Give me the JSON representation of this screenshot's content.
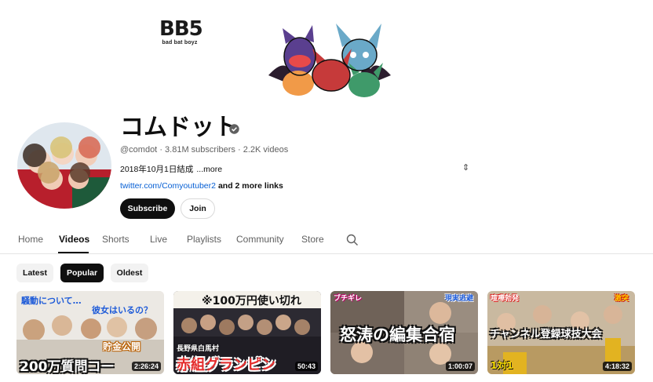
{
  "banner": {
    "brand_main": "BB5",
    "brand_sub": "bad bat boyz"
  },
  "channel": {
    "name": "コムドット",
    "handle": "@comdot",
    "subscribers": "3.81M subscribers",
    "videos": "2.2K videos",
    "description": "2018年10月1日結成",
    "more_label": "...more",
    "link": "twitter.com/Comyoutuber2",
    "more_links": "and 2 more links",
    "subscribe_label": "Subscribe",
    "join_label": "Join"
  },
  "tabs": [
    {
      "label": "Home"
    },
    {
      "label": "Videos"
    },
    {
      "label": "Shorts"
    },
    {
      "label": "Live"
    },
    {
      "label": "Playlists"
    },
    {
      "label": "Community"
    },
    {
      "label": "Store"
    }
  ],
  "chips": [
    {
      "label": "Latest"
    },
    {
      "label": "Popular"
    },
    {
      "label": "Oldest"
    }
  ],
  "videos": [
    {
      "duration": "2:26:24",
      "overlay_top": "騒動について…",
      "overlay_right": "彼女はいるの？",
      "overlay_mid": "貯金公開",
      "overlay_bottom": "200万質問コー"
    },
    {
      "duration": "50:43",
      "overlay_top": "※100万円使い切れ",
      "overlay_mid": "長野県白馬村",
      "overlay_bottom": "赤組グランピン"
    },
    {
      "duration": "1:00:07",
      "overlay_top_left": "ブチギレ",
      "overlay_top_right": "現実逃避",
      "overlay_bottom": "怒涛の編集合宿"
    },
    {
      "duration": "4:18:32",
      "overlay_top_left": "喧嘩勃発",
      "overlay_top_right": "激突",
      "overlay_mid": "チャンネル登録球技大会",
      "overlay_bottom": "1対1"
    }
  ],
  "colors": {
    "link": "#065fd4",
    "subscribe_bg": "#0f0f0f",
    "chip_bg": "#f2f2f2",
    "meta_text": "#606060"
  }
}
